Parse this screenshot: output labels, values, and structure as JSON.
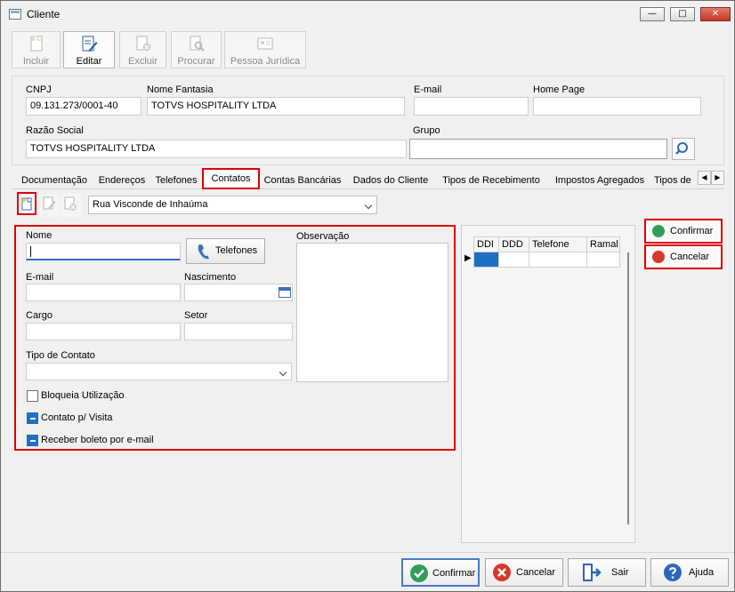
{
  "window": {
    "title": "Cliente",
    "controls": {
      "minimize": "—",
      "maximize": "□",
      "close": "✕"
    }
  },
  "toolbar": {
    "incluir": "Incluir",
    "editar": "Editar",
    "excluir": "Excluir",
    "procurar": "Procurar",
    "pessoa_juridica": "Pessoa Jurídica"
  },
  "header": {
    "cnpj_label": "CNPJ",
    "cnpj_value": "09.131.273/0001-40",
    "nome_fantasia_label": "Nome Fantasia",
    "nome_fantasia_value": "TOTVS HOSPITALITY LTDA",
    "email_label": "E-mail",
    "email_value": "",
    "home_page_label": "Home Page",
    "home_page_value": "",
    "razao_social_label": "Razão Social",
    "razao_social_value": "TOTVS HOSPITALITY LTDA",
    "grupo_label": "Grupo",
    "grupo_value": ""
  },
  "tabs": [
    "Documentação",
    "Endereços",
    "Telefones",
    "Contatos",
    "Contas Bancárias",
    "Dados do Cliente",
    "Tipos de Recebimento",
    "Impostos Agregados",
    "Tipos de"
  ],
  "tab_scroll": {
    "left": "◀",
    "right": "▶"
  },
  "contatos": {
    "address_select": "Rua Visconde de Inhaúma",
    "form": {
      "nome_label": "Nome",
      "nome_value": "",
      "telefones_button": "Telefones",
      "email_label": "E-mail",
      "email_value": "",
      "nascimento_label": "Nascimento",
      "nascimento_value": "",
      "cargo_label": "Cargo",
      "cargo_value": "",
      "setor_label": "Setor",
      "setor_value": "",
      "tipo_contato_label": "Tipo de Contato",
      "tipo_contato_value": "",
      "observacao_label": "Observação",
      "observacao_value": "",
      "bloqueia": {
        "label": "Bloqueia Utilização",
        "checked": false
      },
      "contato_visita": {
        "label": "Contato p/ Visita",
        "checked": true
      },
      "receber_boleto": {
        "label": "Receber boleto por e-mail",
        "checked": true
      }
    },
    "phones_grid": {
      "columns": [
        "DDI",
        "DDD",
        "Telefone",
        "Ramal"
      ],
      "row_marker": "▶"
    },
    "confirmar": "Confirmar",
    "cancelar": "Cancelar"
  },
  "footer": {
    "confirmar": "Confirmar",
    "cancelar": "Cancelar",
    "sair": "Sair",
    "ajuda": "Ajuda"
  },
  "colors": {
    "highlight": "#e00000",
    "confirm_green": "#2f9e58",
    "cancel_red": "#d43a2c",
    "selection_blue": "#1f6fc5"
  }
}
